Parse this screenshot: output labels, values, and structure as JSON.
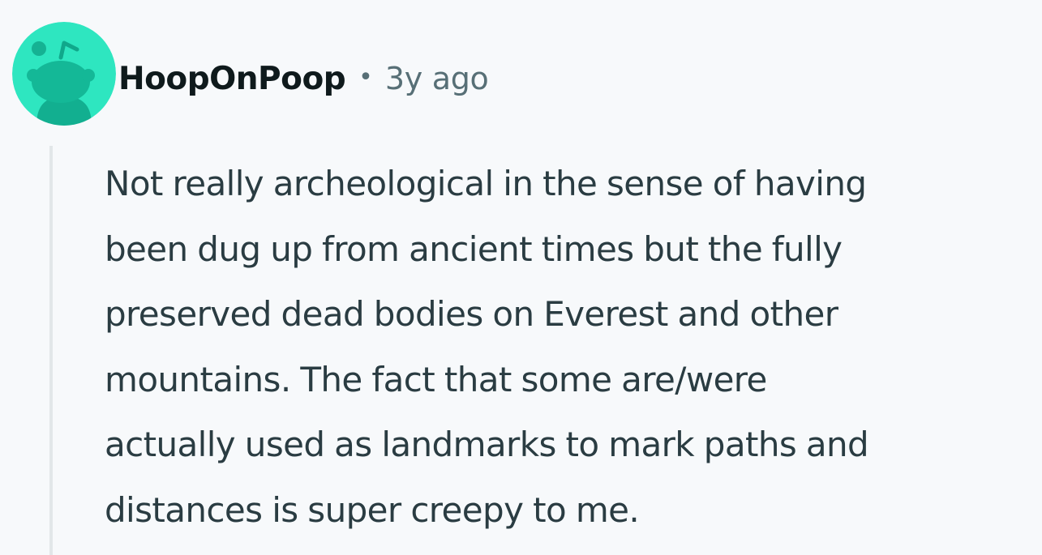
{
  "comment": {
    "author": "HoopOnPoop",
    "separator": "•",
    "timestamp": "3y ago",
    "avatar_icon": "reddit-snoo-avatar-icon",
    "avatar_color": "#2ee6c0",
    "body_lines": [
      "Not really archeological in the sense of having",
      "been dug up from ancient times but the fully",
      "preserved dead bodies on Everest and other",
      "mountains. The fact that some are/were",
      "actually used as landmarks to mark paths and",
      "distances is super creepy to me."
    ]
  }
}
